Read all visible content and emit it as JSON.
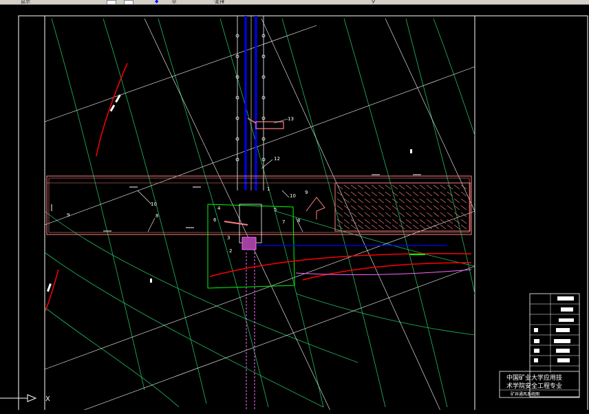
{
  "toolbar": {
    "left_text": "显示",
    "right_text": "·定排",
    "icons": [
      "layer-icon",
      "undo-icon",
      "redo-icon",
      "properties-icon",
      "zoom-icon"
    ]
  },
  "drawing": {
    "colors": {
      "frame": "#ffffff",
      "contour": "#1fbf5f",
      "grid": "#ffffff",
      "shaft": "#0000ff",
      "coal_pillar": "#ff7f7f",
      "fault": "#ff0000",
      "pump_zone": "#00ff00",
      "magenta": "#ff00ff"
    },
    "labels": {
      "n13": "13",
      "n12": "12",
      "n10a": "10",
      "n10b": "10",
      "n9a": "9",
      "n9b": "9",
      "n8a": "8",
      "n8b": "8",
      "n7": "7",
      "n6": "6",
      "n5": "5",
      "n4": "4",
      "n3": "3",
      "n2": "2",
      "n1": "1"
    }
  },
  "title_block": {
    "school_line1": "中国矿业大学应用技",
    "school_line2": "术学院安全工程专业",
    "drawing_name": "矿井通风系统图"
  },
  "command_line": {
    "prompt": "X"
  }
}
